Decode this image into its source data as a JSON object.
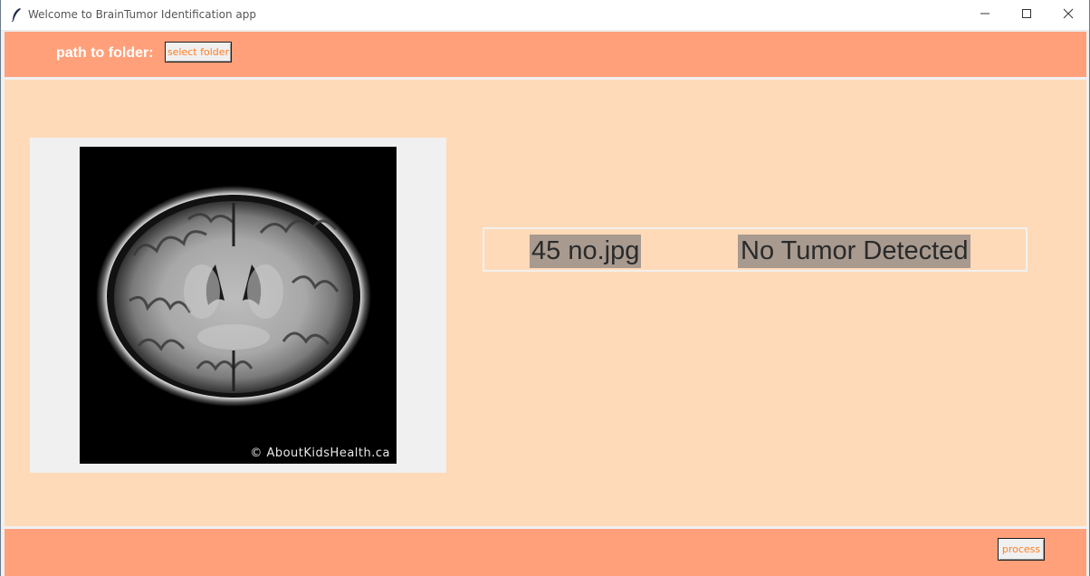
{
  "window": {
    "title": "Welcome to BrainTumor Identification app",
    "controls": [
      "minimize",
      "maximize",
      "close"
    ]
  },
  "topbar": {
    "path_label": "path to folder:",
    "select_button": "select folder"
  },
  "image_panel": {
    "watermark": "© AboutKidsHealth.ca"
  },
  "result": {
    "filename": "45 no.jpg",
    "prediction": "No Tumor Detected"
  },
  "bottombar": {
    "process_button": "process"
  },
  "colors": {
    "bar": "#ffa07a",
    "background": "#ffdab9",
    "button_text": "#ff7f24",
    "result_highlight": "#a89a8f"
  },
  "icons": {
    "app": "feather-icon",
    "minimize": "minimize-icon",
    "maximize": "maximize-icon",
    "close": "close-icon"
  }
}
